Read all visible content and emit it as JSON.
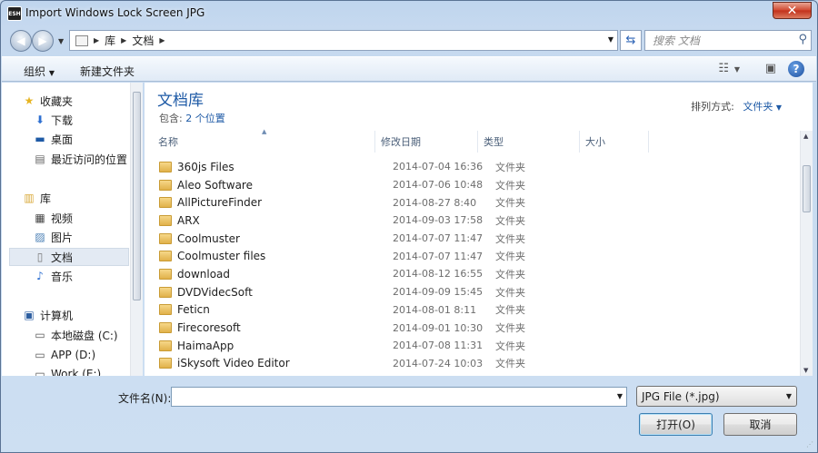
{
  "window": {
    "title": "Import Windows Lock Screen JPG",
    "app_icon_text": "ESH",
    "close_label": "✕"
  },
  "navigation": {
    "breadcrumb": [
      "库",
      "文档"
    ],
    "search_placeholder": "搜索 文档"
  },
  "toolbar": {
    "organize": "组织",
    "new_folder": "新建文件夹"
  },
  "sidebar": {
    "favorites": {
      "label": "收藏夹",
      "items": [
        "下载",
        "桌面",
        "最近访问的位置"
      ]
    },
    "libraries": {
      "label": "库",
      "items": [
        "视频",
        "图片",
        "文档",
        "音乐"
      ]
    },
    "computer": {
      "label": "计算机",
      "items": [
        "本地磁盘 (C:)",
        "APP (D:)",
        "Work (E:)"
      ]
    }
  },
  "library": {
    "title": "文档库",
    "includes_label": "包含:",
    "includes_link": "2 个位置",
    "arrange_label": "排列方式:",
    "arrange_value": "文件夹"
  },
  "columns": {
    "name": "名称",
    "date": "修改日期",
    "type": "类型",
    "size": "大小"
  },
  "files": [
    {
      "name": "360js Files",
      "date": "2014-07-04 16:36",
      "type": "文件夹"
    },
    {
      "name": "Aleo Software",
      "date": "2014-07-06 10:48",
      "type": "文件夹"
    },
    {
      "name": "AllPictureFinder",
      "date": "2014-08-27 8:40",
      "type": "文件夹"
    },
    {
      "name": "ARX",
      "date": "2014-09-03 17:58",
      "type": "文件夹"
    },
    {
      "name": "Coolmuster",
      "date": "2014-07-07 11:47",
      "type": "文件夹"
    },
    {
      "name": "Coolmuster files",
      "date": "2014-07-07 11:47",
      "type": "文件夹"
    },
    {
      "name": "download",
      "date": "2014-08-12 16:55",
      "type": "文件夹"
    },
    {
      "name": "DVDVidecSoft",
      "date": "2014-09-09 15:45",
      "type": "文件夹"
    },
    {
      "name": "Feticn",
      "date": "2014-08-01 8:11",
      "type": "文件夹"
    },
    {
      "name": "Firecoresoft",
      "date": "2014-09-01 10:30",
      "type": "文件夹"
    },
    {
      "name": "HaimaApp",
      "date": "2014-07-08 11:31",
      "type": "文件夹"
    },
    {
      "name": "iSkysoft Video Editor",
      "date": "2014-07-24 10:03",
      "type": "文件夹"
    }
  ],
  "footer": {
    "filename_label": "文件名(N):",
    "filename_value": "",
    "filetype": "JPG File (*.jpg)",
    "open_button": "打开(O)",
    "cancel_button": "取消"
  }
}
